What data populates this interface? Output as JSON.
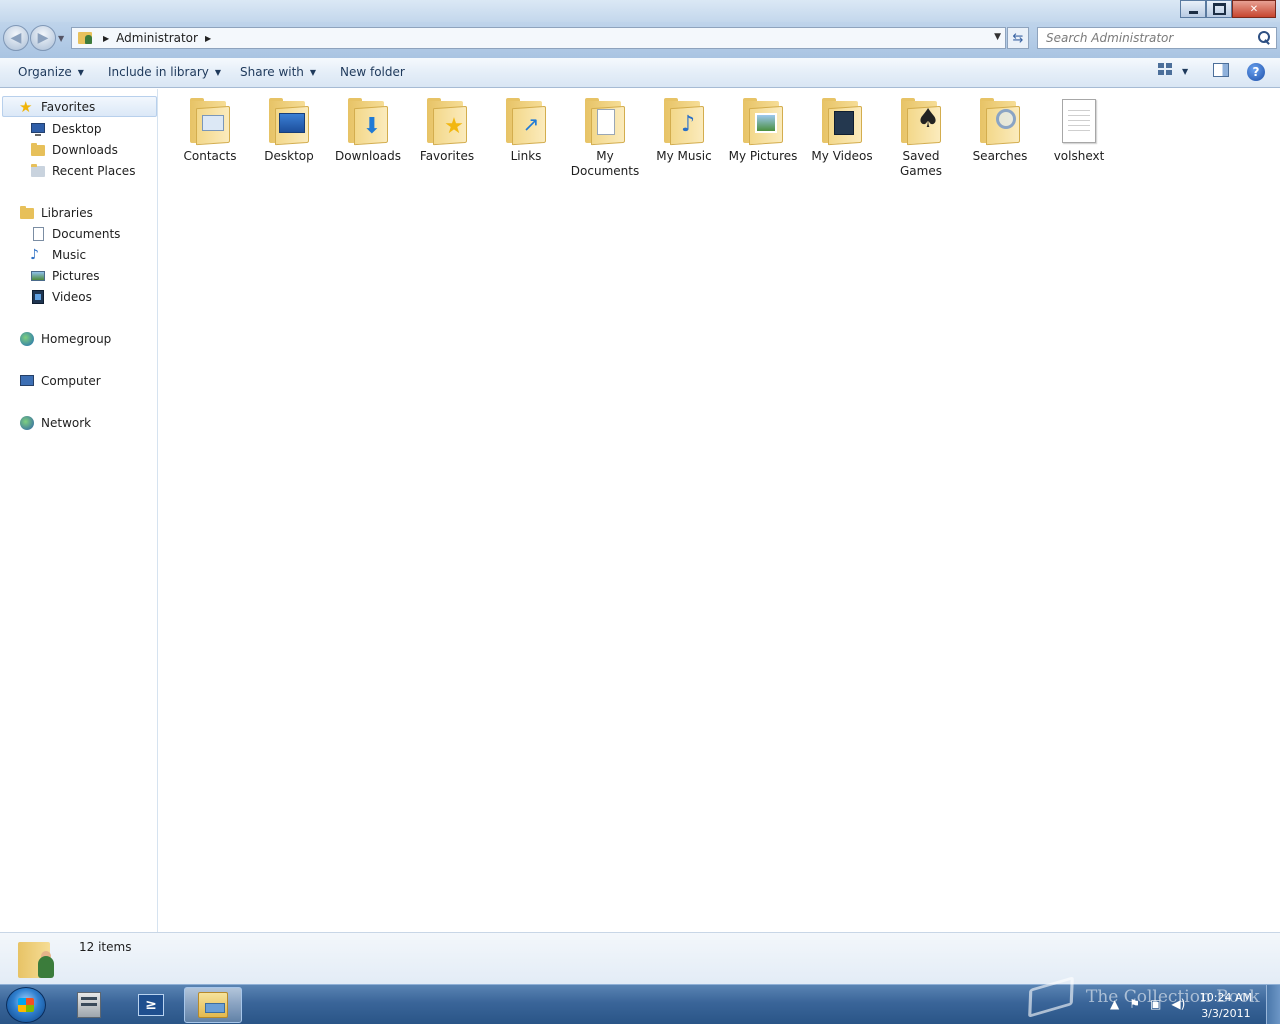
{
  "window": {
    "controls": {
      "minimize": "minimize",
      "maximize": "restore",
      "close": "close"
    }
  },
  "address": {
    "crumbs": [
      "Administrator"
    ],
    "icon": "user-folder-icon"
  },
  "search": {
    "placeholder": "Search Administrator"
  },
  "toolbar": {
    "organize": "Organize",
    "include_in_library": "Include in library",
    "share_with": "Share with",
    "new_folder": "New folder"
  },
  "sidebar": {
    "favorites": {
      "label": "Favorites",
      "items": [
        {
          "label": "Desktop",
          "icon": "desktop-icon"
        },
        {
          "label": "Downloads",
          "icon": "downloads-icon"
        },
        {
          "label": "Recent Places",
          "icon": "recent-places-icon"
        }
      ]
    },
    "libraries": {
      "label": "Libraries",
      "items": [
        {
          "label": "Documents",
          "icon": "documents-icon"
        },
        {
          "label": "Music",
          "icon": "music-icon"
        },
        {
          "label": "Pictures",
          "icon": "pictures-icon"
        },
        {
          "label": "Videos",
          "icon": "videos-icon"
        }
      ]
    },
    "homegroup": "Homegroup",
    "computer": "Computer",
    "network": "Network"
  },
  "content": {
    "items": [
      {
        "label": "Contacts",
        "icon": "contacts-folder-icon"
      },
      {
        "label": "Desktop",
        "icon": "desktop-folder-icon"
      },
      {
        "label": "Downloads",
        "icon": "downloads-folder-icon"
      },
      {
        "label": "Favorites",
        "icon": "favorites-folder-icon"
      },
      {
        "label": "Links",
        "icon": "links-folder-icon"
      },
      {
        "label": "My Documents",
        "icon": "documents-folder-icon"
      },
      {
        "label": "My Music",
        "icon": "music-folder-icon"
      },
      {
        "label": "My Pictures",
        "icon": "pictures-folder-icon"
      },
      {
        "label": "My Videos",
        "icon": "videos-folder-icon"
      },
      {
        "label": "Saved Games",
        "icon": "saved-games-folder-icon"
      },
      {
        "label": "Searches",
        "icon": "searches-folder-icon"
      },
      {
        "label": "volshext",
        "icon": "text-file-icon"
      }
    ]
  },
  "details": {
    "count": "12 items"
  },
  "taskbar": {
    "time": "10:24 AM",
    "date": "3/3/2011",
    "watermark": "The Collection Book"
  },
  "colors": {
    "accent": "#1e395b",
    "folder": "#e7c366",
    "taskbar": "#3a6599"
  }
}
